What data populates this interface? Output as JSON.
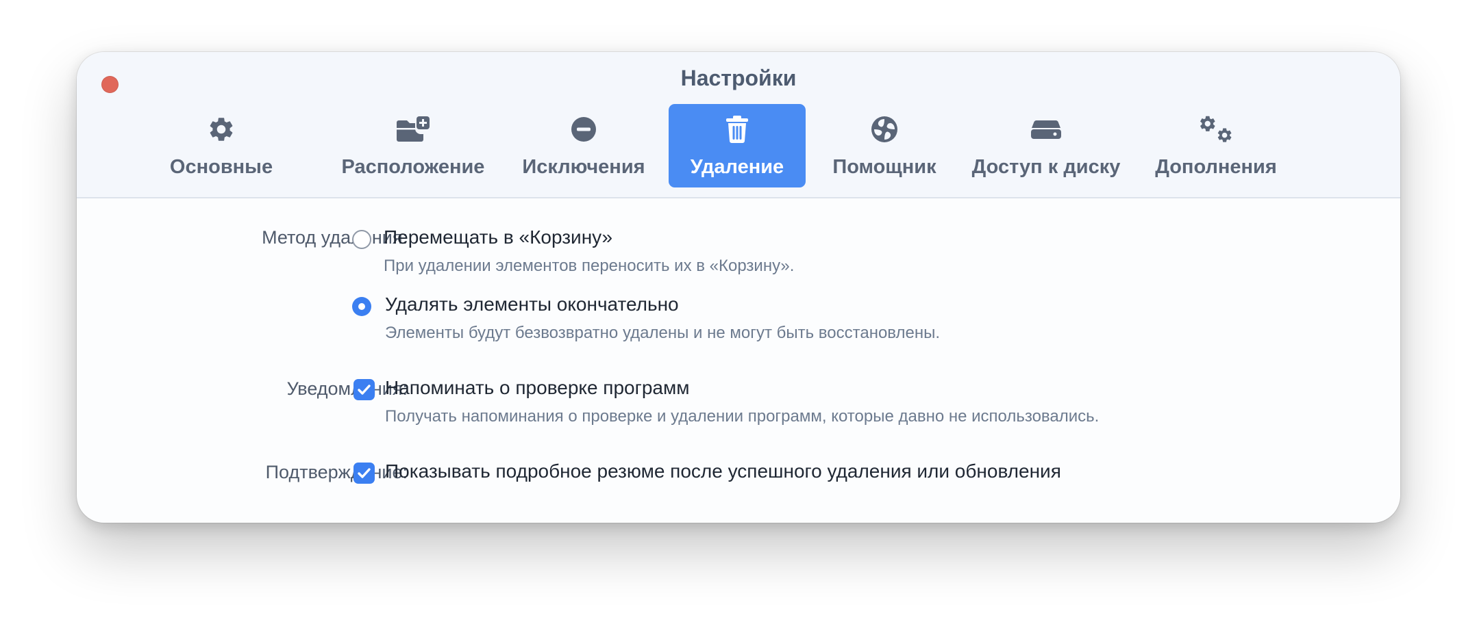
{
  "window": {
    "title": "Настройки"
  },
  "tabs": [
    {
      "label": "Основные",
      "icon": "gear-icon"
    },
    {
      "label": "Расположение",
      "icon": "folder-plus-icon"
    },
    {
      "label": "Исключения",
      "icon": "minus-circle-icon"
    },
    {
      "label": "Удаление",
      "icon": "trash-icon",
      "active": true
    },
    {
      "label": "Помощник",
      "icon": "helper-swirl-icon"
    },
    {
      "label": "Доступ к диску",
      "icon": "disk-icon"
    },
    {
      "label": "Дополнения",
      "icon": "gears-icon"
    }
  ],
  "settings": {
    "delete_method": {
      "label": "Метод удаления:",
      "options": [
        {
          "title": "Перемещать в «Корзину»",
          "description": "При удалении элементов переносить их в «Корзину».",
          "selected": false
        },
        {
          "title": "Удалять элементы окончательно",
          "description": "Элементы будут безвозвратно удалены и не могут быть восстановлены.",
          "selected": true
        }
      ]
    },
    "notifications": {
      "label": "Уведомления:",
      "title": "Напоминать о проверке программ",
      "description": "Получать напоминания о проверке и удалении программ, которые давно не использовались.",
      "checked": true
    },
    "confirmation": {
      "label": "Подтверждение:",
      "title": "Показывать подробное резюме после успешного удаления или обновления",
      "checked": true
    }
  },
  "colors": {
    "accent": "#4a8cf3",
    "close": "#e0685a",
    "text_primary": "#1f2733",
    "text_secondary": "#6c7a8e"
  }
}
